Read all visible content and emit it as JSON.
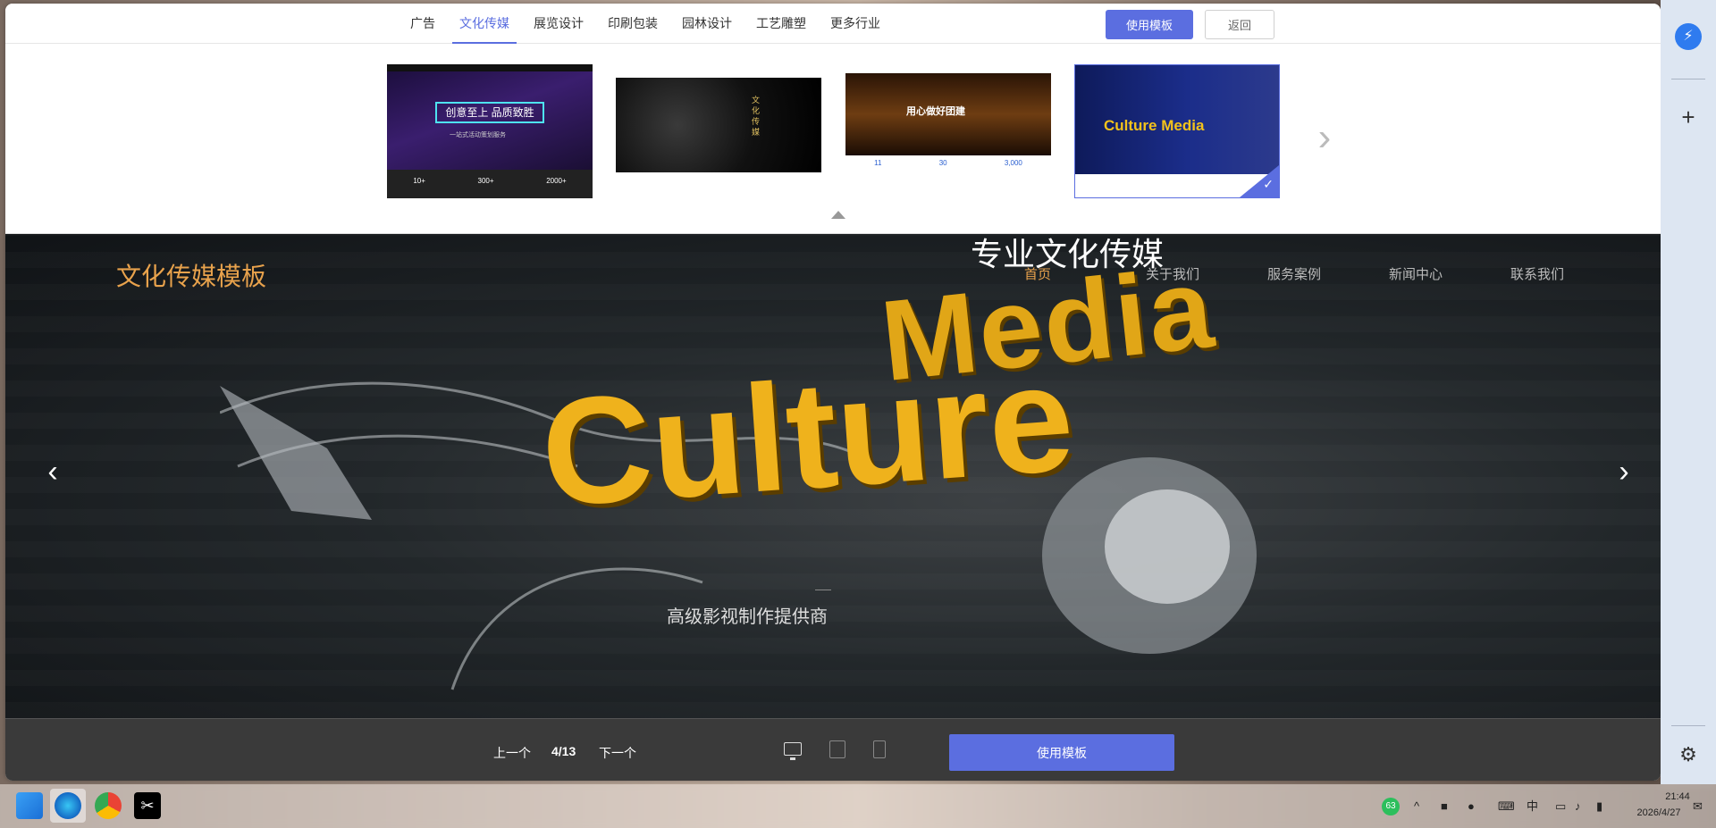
{
  "categories": [
    "广告",
    "文化传媒",
    "展览设计",
    "印刷包装",
    "园林设计",
    "工艺雕塑",
    "更多行业"
  ],
  "active_category": "文化传媒",
  "top_buttons": {
    "use_template": "使用模板",
    "back": "返回"
  },
  "thumbnails": [
    {
      "caption": "创意至上 品质致胜",
      "sub": "一站式活动策划服务",
      "stats": [
        "10+",
        "300+",
        "2000+"
      ]
    },
    {
      "caption": "文化传媒"
    },
    {
      "caption": "用心做好团建",
      "stats": [
        "11",
        "30",
        "3,000"
      ]
    },
    {
      "caption": "Culture Media",
      "selected": true
    }
  ],
  "preview": {
    "logo": "文化传媒模板",
    "nav": [
      "首页",
      "关于我们",
      "服务案例",
      "新闻中心",
      "联系我们"
    ],
    "nav_active": "首页",
    "hero_top": "专业文化传媒",
    "hero_word1": "Culture",
    "hero_word2": "Media",
    "hero_subtitle": "高级影视制作提供商"
  },
  "controls": {
    "prev": "上一个",
    "counter": "4/13",
    "next": "下一个",
    "use_template": "使用模板"
  },
  "taskbar": {
    "badge": "63",
    "ime": "中",
    "time": "21:44",
    "date": "2026/4/27"
  },
  "colors": {
    "accent": "#5b6ee0",
    "hero_gold": "#efb21c",
    "logo_orange": "#e8a24c"
  }
}
